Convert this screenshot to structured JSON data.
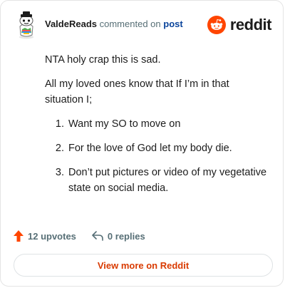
{
  "comment": {
    "username": "ValdeReads",
    "verb": "commented on",
    "post_link": "post",
    "intro": "NTA holy crap this is sad.",
    "lead": "All my loved ones know that If I’m in that situation I;",
    "list_items": [
      "Want my SO to move on",
      "For the love of God let my body die.",
      "Don’t put pictures or video of my vegetative state on social media."
    ]
  },
  "brand": {
    "wordmark": "reddit",
    "color": "#ff4500"
  },
  "actions": {
    "upvotes": "12 upvotes",
    "replies": "0 replies",
    "upvote_color": "#ff4500"
  },
  "footer": {
    "view_more": "View more on Reddit",
    "view_more_color": "#d93a00"
  }
}
